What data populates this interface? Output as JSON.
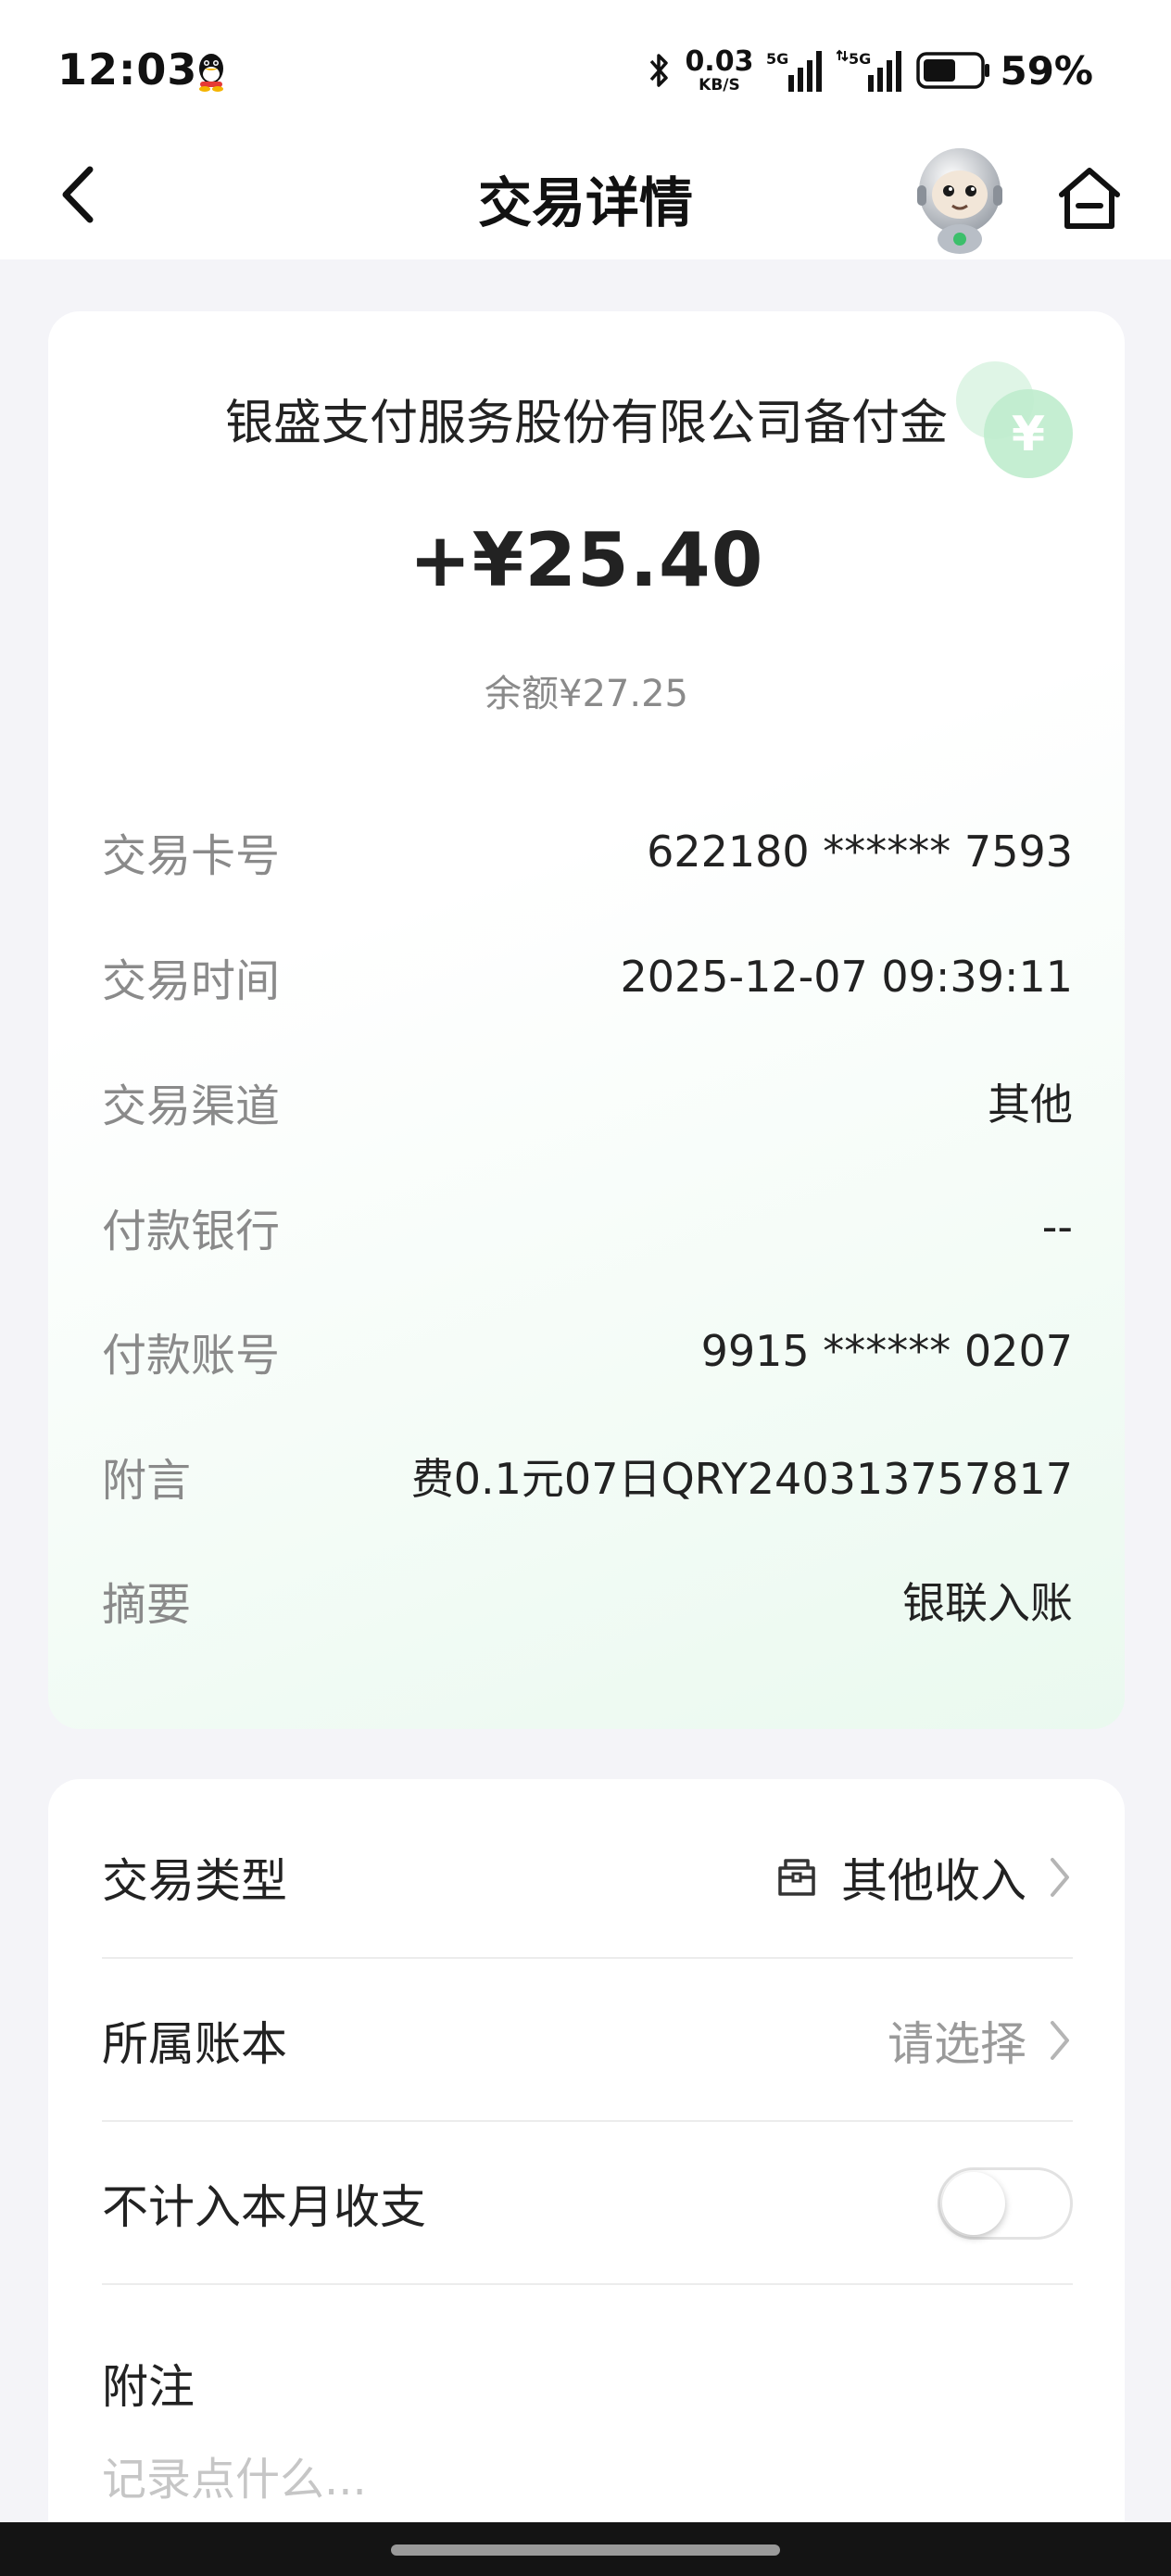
{
  "status_bar": {
    "time": "12:03",
    "net_speed_value": "0.03",
    "net_speed_unit": "KB/S",
    "signal1_label": "5G",
    "signal2_label": "5G",
    "battery_percent": "59%",
    "battery_level": 0.59
  },
  "nav": {
    "title": "交易详情",
    "back_icon": "chevron-left-icon",
    "home_icon": "home-icon"
  },
  "transaction": {
    "counterparty": "银盛支付服务股份有限公司备付金",
    "amount": "+¥25.40",
    "balance": "余额¥27.25",
    "badge_symbol": "¥",
    "details": [
      {
        "label": "交易卡号",
        "value": "622180 ****** 7593"
      },
      {
        "label": "交易时间",
        "value": "2025-12-07 09:39:11"
      },
      {
        "label": "交易渠道",
        "value": "其他"
      },
      {
        "label": "付款银行",
        "value": "--"
      },
      {
        "label": "付款账号",
        "value": "9915 ****** 0207"
      },
      {
        "label": "附言",
        "value": "费0.1元07日QRY240313757817"
      },
      {
        "label": "摘要",
        "value": "银联入账"
      }
    ]
  },
  "settings": {
    "type_label": "交易类型",
    "type_value": "其他收入",
    "type_icon": "envelope-icon",
    "ledger_label": "所属账本",
    "ledger_placeholder": "请选择",
    "exclude_label": "不计入本月收支",
    "exclude_enabled": false,
    "note_label": "附注",
    "note_placeholder": "记录点什么..."
  },
  "colors": {
    "accent_green": "#3cbf6b",
    "badge_green": "#a8e6bd",
    "text_primary": "#222222",
    "text_secondary": "#8a8a8a"
  }
}
